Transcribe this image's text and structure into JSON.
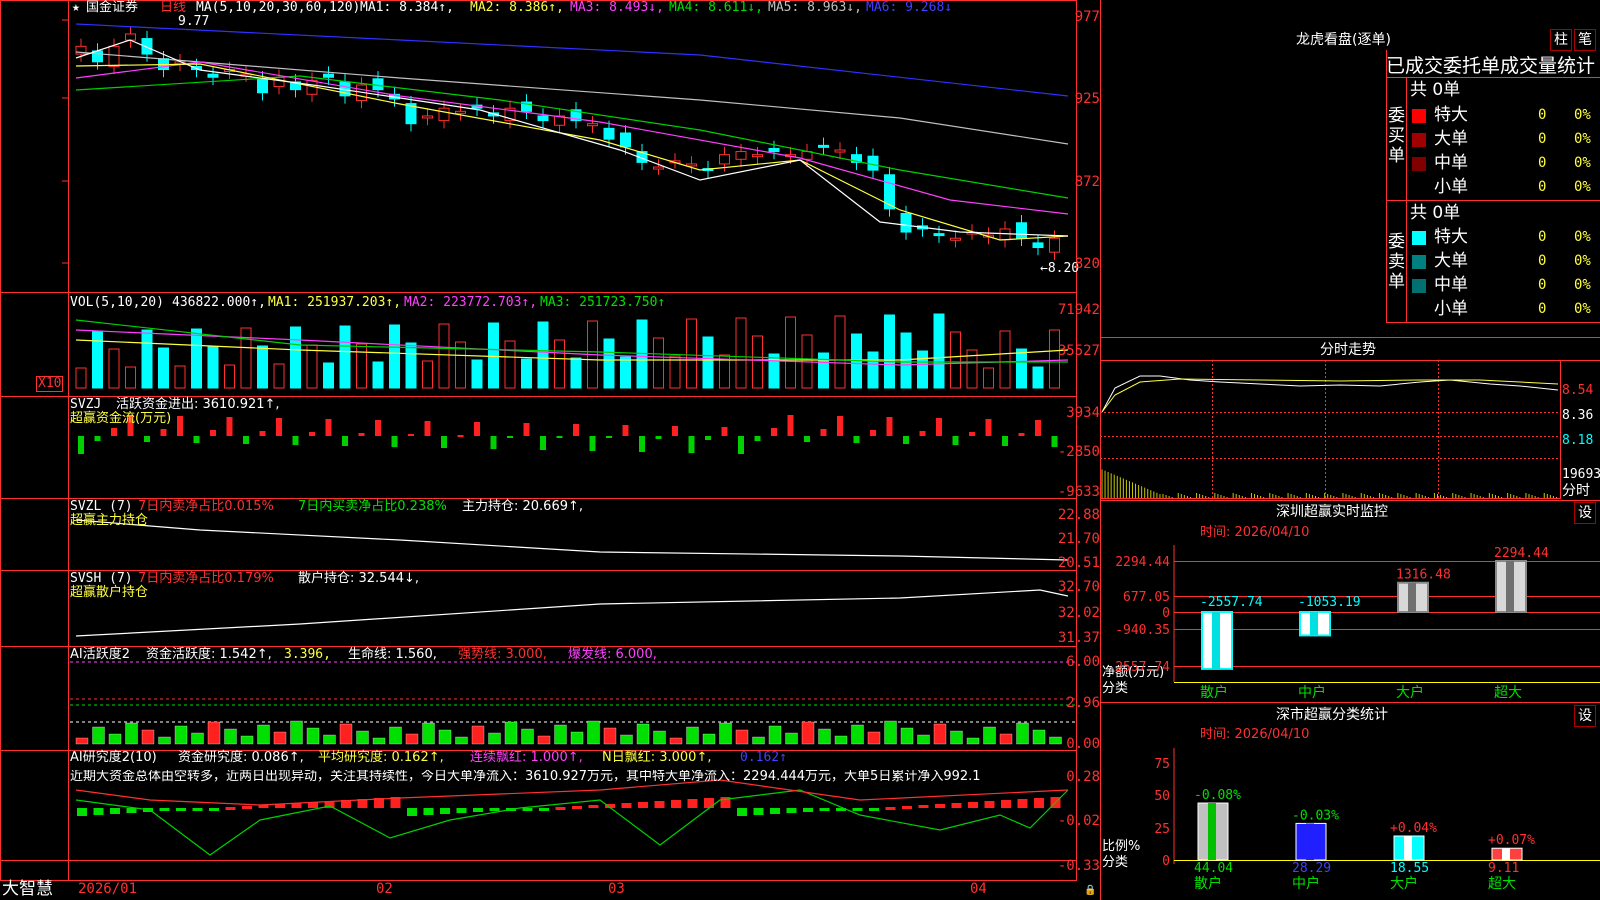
{
  "app": {
    "brand": "大智慧",
    "stock_name": "国金证券",
    "period": "日线"
  },
  "main": {
    "ma_label": "MA(5,10,20,30,60,120)",
    "ma1": "MA1: 8.384↑,",
    "ma2": "MA2: 8.386↑,",
    "ma3": "MA3: 8.493↓,",
    "ma4": "MA4: 8.611↓,",
    "ma5": "MA5: 8.963↓,",
    "ma6": "MA6: 9.268↓",
    "high_mark": "9.77",
    "low_mark": "8.20",
    "ticks": [
      "977",
      "925",
      "872",
      "820"
    ]
  },
  "vol": {
    "label": "VOL(5,10,20)",
    "value": "436822.000↑,",
    "ma1": "MA1: 251937.203↑,",
    "ma2": "MA2: 223772.703↑,",
    "ma3": "MA3: 251723.750↑",
    "ticks": [
      "71942",
      "35527"
    ],
    "unit": "X10"
  },
  "svzj": {
    "label": "SVZJ",
    "value": "活跃资金进出: 3610.921↑,",
    "sub": "超赢资金流(万元)",
    "ticks": [
      "3934",
      "-2850",
      "-9633"
    ]
  },
  "svzl": {
    "label": "SVZL (7)",
    "v1": "7日内卖净占比0.015%",
    "v2": "7日内买卖净占比0.238%",
    "v3": "主力持仓: 20.669↑,",
    "sub": "超赢主力持仓",
    "ticks": [
      "22.88",
      "21.70",
      "20.51"
    ]
  },
  "svsh": {
    "label": "SVSH (7)",
    "v1": "7日内卖净占比0.179%",
    "v2": "散户持仓: 32.544↓,",
    "sub": "超赢散户持仓",
    "ticks": [
      "32.70",
      "32.02",
      "31.37"
    ]
  },
  "ai1": {
    "label": "AI活跃度2",
    "v1": "资金活跃度: 1.542↑,",
    "v2": "3.396,",
    "v3": "生命线: 1.560,",
    "v4": "强势线: 3.000,",
    "v5": "爆发线: 6.000,",
    "ticks": [
      "6.00",
      "2.96",
      "0.00"
    ]
  },
  "ai2": {
    "label": "AI研究度2(10)",
    "v1": "资金研究度: 0.086↑,",
    "v2": "平均研究度: 0.162↑,",
    "v3": "连续飘红: 1.000↑,",
    "v4": "N日飘红: 3.000↑,",
    "v5": "0.162↑",
    "comment": "近期大资金总体由空转多，近两日出现异动，关注其持续性，今日大单净流入：3610.927万元，其中特大单净流入：2294.444万元，大单5日累计净入992.1",
    "ticks": [
      "0.28",
      "-0.02",
      "-0.33"
    ]
  },
  "xaxis": [
    "2026/01",
    "02",
    "03",
    "04"
  ],
  "lhb": {
    "title": "龙虎看盘(逐单)",
    "btn1": "柱",
    "btn2": "笔",
    "header": "已成交委托单成交量统计",
    "buy_label": "委买单",
    "sell_label": "委卖单",
    "buy_total": "共 0单",
    "sell_total": "共 0单",
    "rows": [
      "特大",
      "大单",
      "中单",
      "小单"
    ],
    "zero": "0",
    "pct": "0%",
    "buy_colors": [
      "#ff0000",
      "#a00000",
      "#800000",
      "#000000"
    ],
    "sell_colors": [
      "#00ffff",
      "#008080",
      "#007070",
      "#000000"
    ]
  },
  "fs": {
    "title": "分时走势",
    "ticks": [
      "8.54",
      "8.36",
      "8.18"
    ],
    "vol_tick": "19693",
    "unit": "分时"
  },
  "monitor": {
    "title": "深圳超赢实时监控",
    "set": "设",
    "time": "时间: 2026/04/10",
    "ticks": [
      "2294.44",
      "677.05",
      "0",
      "-940.35",
      "-2557.74"
    ],
    "ylabel": "净额(万元)",
    "xlabel": "分类",
    "categories": [
      "散户",
      "中户",
      "大户",
      "超大"
    ],
    "values": [
      -2557.74,
      -1053.19,
      1316.48,
      2294.44
    ],
    "value_labels": [
      "-2557.74",
      "-1053.19",
      "1316.48",
      "2294.44"
    ]
  },
  "classify": {
    "title": "深市超赢分类统计",
    "set": "设",
    "time": "时间: 2026/04/10",
    "ticks": [
      "75",
      "50",
      "25",
      "0"
    ],
    "ylabel": "比例%",
    "xlabel": "分类",
    "categories": [
      "散户",
      "中户",
      "大户",
      "超大"
    ],
    "values": [
      44.04,
      28.29,
      18.55,
      9.11
    ],
    "value_labels": [
      "44.04",
      "28.29",
      "18.55",
      "9.11"
    ],
    "changes": [
      "-0.08%",
      "-0.03%",
      "+0.04%",
      "+0.07%"
    ]
  }
}
